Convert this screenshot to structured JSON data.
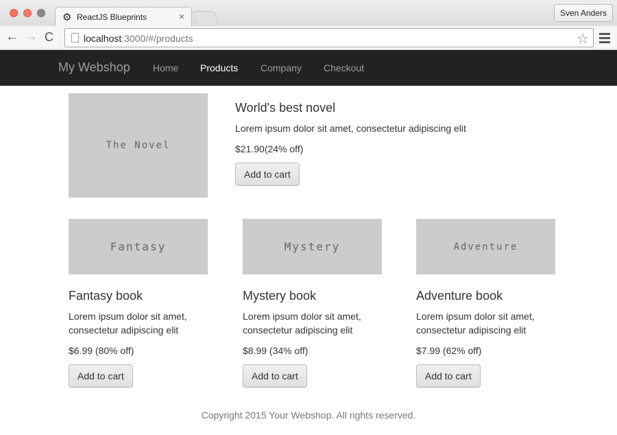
{
  "browser": {
    "tab_title": "ReactJS Blueprints",
    "tab_close": "×",
    "tab_icon": "gear-icon",
    "user_button": "Sven Anders",
    "url_host": "localhost",
    "url_path": ":3000/#/products",
    "back_glyph": "←",
    "forward_glyph": "→",
    "reload_glyph": "C",
    "star_glyph": "☆",
    "gear_glyph": "⚙"
  },
  "nav": {
    "brand": "My Webshop",
    "items": [
      {
        "label": "Home",
        "active": false
      },
      {
        "label": "Products",
        "active": true
      },
      {
        "label": "Company",
        "active": false
      },
      {
        "label": "Checkout",
        "active": false
      }
    ]
  },
  "featured": {
    "image_text": "The Novel",
    "title": "World's best novel",
    "description": "Lorem ipsum dolor sit amet, consectetur adipiscing elit",
    "price": "$21.90(24% off)",
    "button": "Add to cart"
  },
  "products": [
    {
      "image_text": "Fantasy",
      "title": "Fantasy book",
      "description_line1": "Lorem ipsum dolor sit amet,",
      "description_line2": "consectetur adipiscing elit",
      "price": "$6.99 (80% off)",
      "button": "Add to cart"
    },
    {
      "image_text": "Mystery",
      "title": "Mystery book",
      "description_line1": "Lorem ipsum dolor sit amet,",
      "description_line2": "consectetur adipiscing elit",
      "price": "$8.99 (34% off)",
      "button": "Add to cart"
    },
    {
      "image_text": "Adventure",
      "title": "Adventure book",
      "description_line1": "Lorem ipsum dolor sit amet,",
      "description_line2": "consectetur adipiscing elit",
      "price": "$7.99 (62% off)",
      "button": "Add to cart"
    }
  ],
  "footer": "Copyright 2015 Your Webshop. All rights reserved.",
  "colors": {
    "navbar_bg": "#222222",
    "placeholder_bg": "#cccccc",
    "active_nav": "#ffffff",
    "inactive_nav": "#9d9d9d"
  }
}
